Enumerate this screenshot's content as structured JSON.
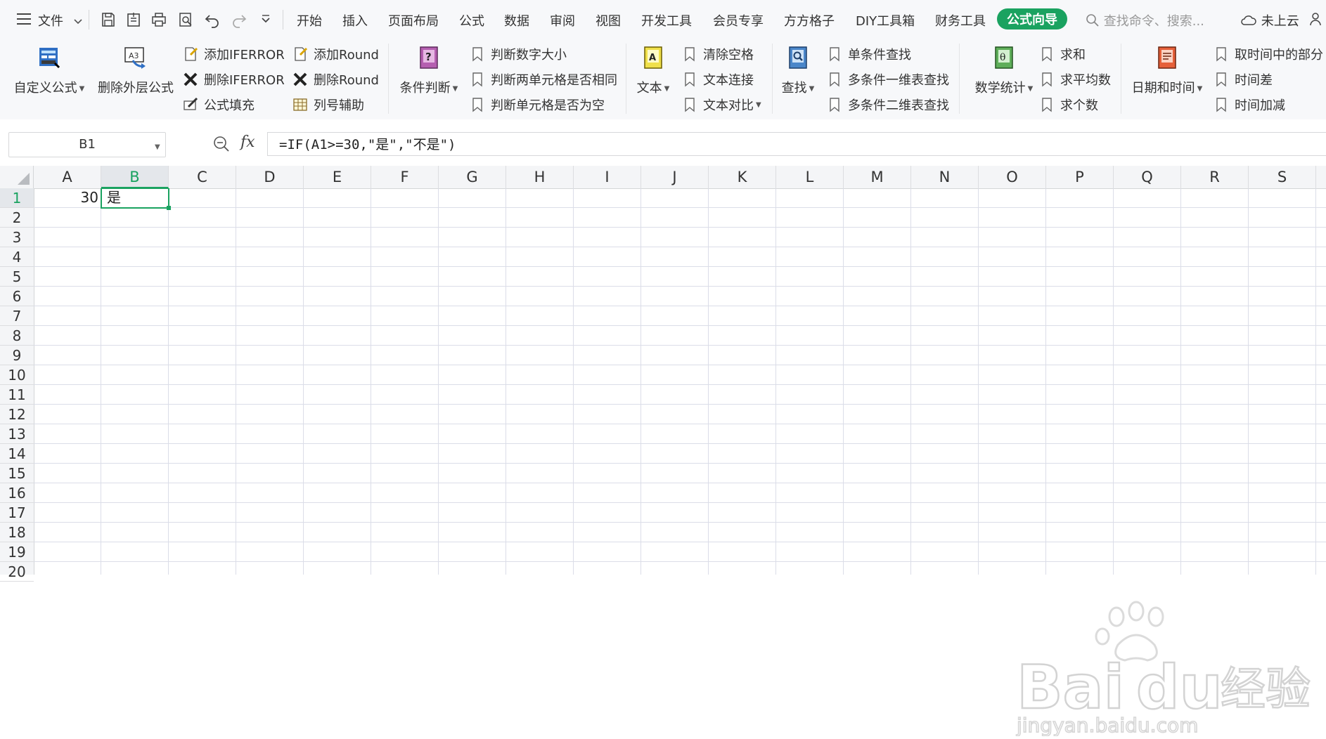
{
  "menubar": {
    "file_label": "文件",
    "tabs": [
      "开始",
      "插入",
      "页面布局",
      "公式",
      "数据",
      "审阅",
      "视图",
      "开发工具",
      "会员专享",
      "方方格子",
      "DIY工具箱",
      "财务工具",
      "公式向导"
    ],
    "active_tab": "公式向导",
    "search_placeholder": "查找命令、搜索...",
    "cloud_label": "未上云"
  },
  "ribbon": {
    "custom_formula": "自定义公式",
    "remove_outer": "删除外层公式",
    "add_iferror": "添加IFERROR",
    "del_iferror": "删除IFERROR",
    "formula_fill": "公式填充",
    "add_round": "添加Round",
    "del_round": "删除Round",
    "col_helper": "列号辅助",
    "cond_judge": "条件判断",
    "judge_num_size": "判断数字大小",
    "judge_two_same": "判断两单元格是否相同",
    "judge_cell_empty": "判断单元格是否为空",
    "text": "文本",
    "clear_space": "清除空格",
    "text_join": "文本连接",
    "text_compare": "文本对比",
    "find": "查找",
    "single_lookup": "单条件查找",
    "multi_1d_lookup": "多条件一维表查找",
    "multi_2d_lookup": "多条件二维表查找",
    "math_stats": "数学统计",
    "sum": "求和",
    "average": "求平均数",
    "count": "求个数",
    "date_time": "日期和时间",
    "get_time_part": "取时间中的部分",
    "time_diff": "时间差",
    "time_add": "时间加减"
  },
  "formula_bar": {
    "name_box": "B1",
    "fx_label": "fx",
    "formula": "=IF(A1>=30,\"是\",\"不是\")"
  },
  "grid": {
    "columns": [
      "A",
      "B",
      "C",
      "D",
      "E",
      "F",
      "G",
      "H",
      "I",
      "J",
      "K",
      "L",
      "M",
      "N",
      "O",
      "P",
      "Q",
      "R",
      "S"
    ],
    "rows": [
      "1",
      "2",
      "3",
      "4",
      "5",
      "6",
      "7",
      "8",
      "9",
      "10",
      "11",
      "12",
      "13",
      "14",
      "15",
      "16",
      "17",
      "18",
      "19",
      "20"
    ],
    "selected_column": "B",
    "selected_row": "1",
    "cells": {
      "A1": "30",
      "B1": "是"
    }
  },
  "colors": {
    "accent": "#1aa260"
  }
}
